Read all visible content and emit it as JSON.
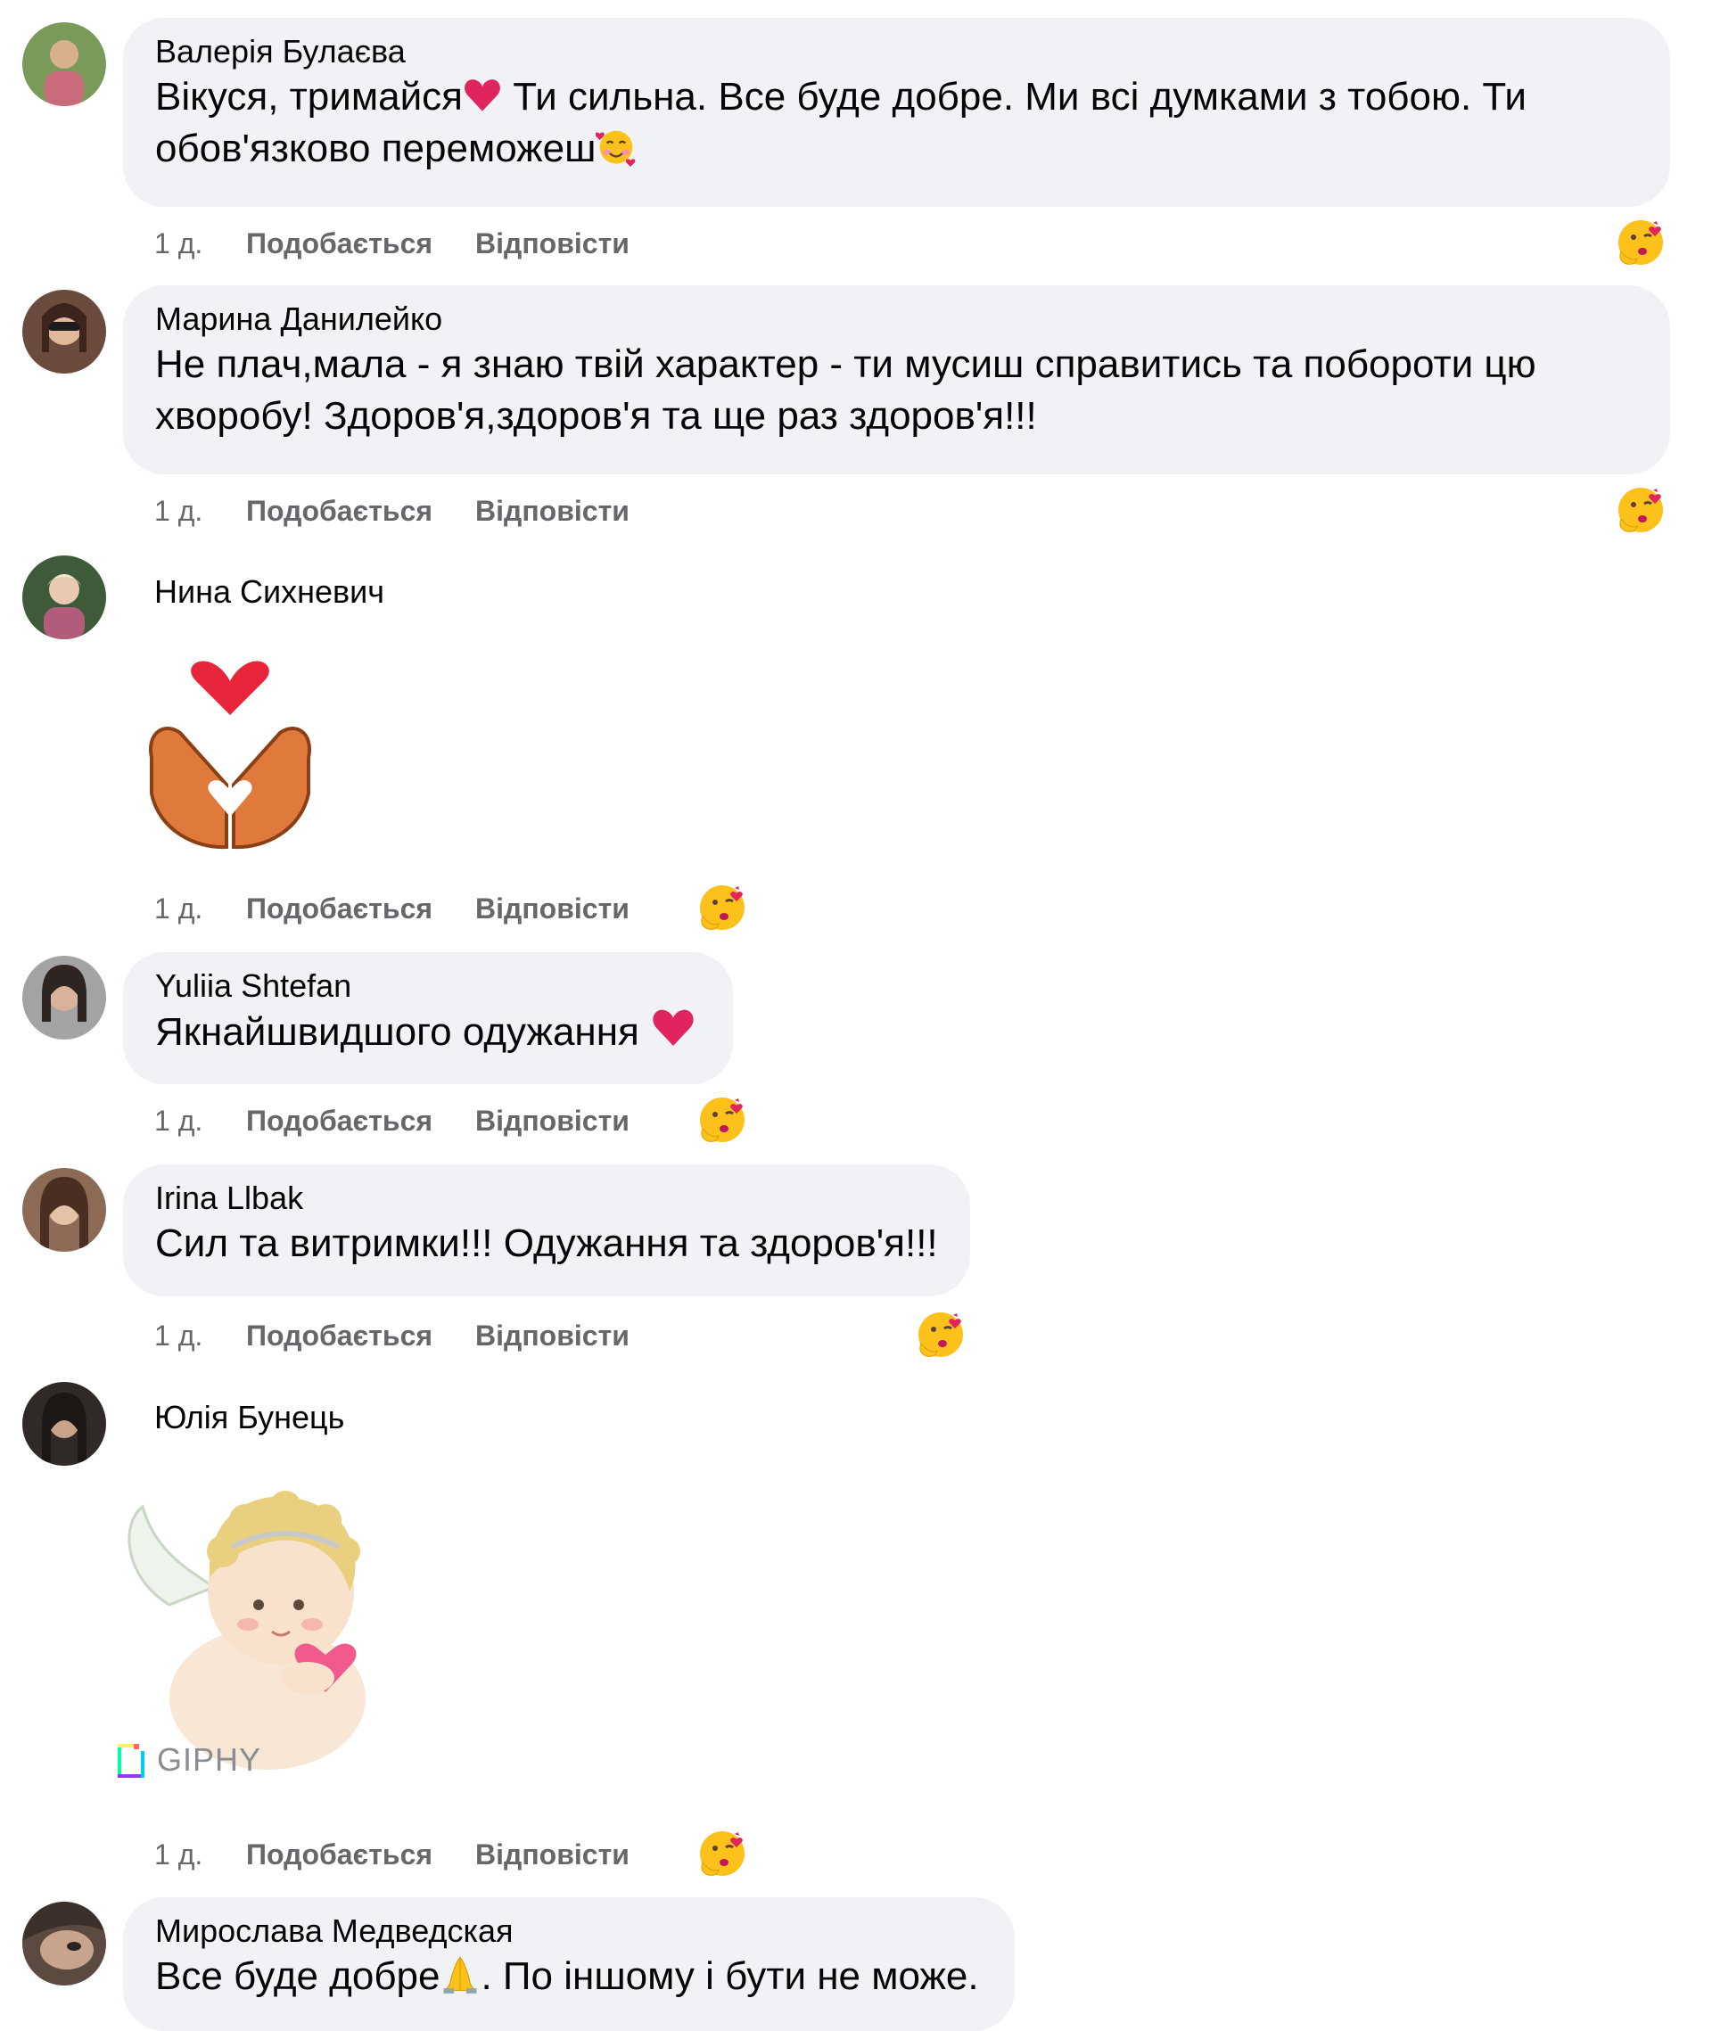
{
  "comments": [
    {
      "author": "Валерія Булаєва",
      "text_parts": [
        "Вікуся, тримайся",
        " Ти сильна. Все буде добре. Ми всі думками з тобою. Ти обов'язково переможеш"
      ],
      "time": "1 д.",
      "like_label": "Подобається",
      "reply_label": "Відповісти"
    },
    {
      "author": "Марина Данилейко",
      "text": "Не плач,мала - я знаю твій характер - ти мусиш справитись та побороти цю хворобу! Здоров'я,здоров'я та ще раз здоров'я!!!",
      "time": "1 д.",
      "like_label": "Подобається",
      "reply_label": "Відповісти"
    },
    {
      "author": "Нина Сихневич",
      "sticker": "heart-hands-sticker",
      "time": "1 д.",
      "like_label": "Подобається",
      "reply_label": "Відповісти"
    },
    {
      "author": "Yuliia Shtefan",
      "text": "Якнайшвидшого одужання",
      "time": "1 д.",
      "like_label": "Подобається",
      "reply_label": "Відповісти"
    },
    {
      "author": "Irina Llbak",
      "text": "Сил та витримки!!! Одужання та здоров'я!!!",
      "time": "1 д.",
      "like_label": "Подобається",
      "reply_label": "Відповісти"
    },
    {
      "author": "Юлія Бунець",
      "sticker": "angel-with-heart-gif",
      "gif_provider": "GIPHY",
      "time": "1 д.",
      "like_label": "Подобається",
      "reply_label": "Відповісти"
    },
    {
      "author": "Мирослава Медведская",
      "text_parts": [
        "Все буде добре",
        ". По іншому і бути не може."
      ]
    }
  ],
  "icons": {
    "reaction": "hugging-face-react-icon",
    "heart": "red-heart-icon",
    "smiling_hearts": "smiling-face-with-hearts-icon",
    "pray": "folded-hands-icon"
  },
  "colors": {
    "bubble": "#f0f2f5",
    "meta_text": "#65676b",
    "heart": "#e0245e"
  }
}
